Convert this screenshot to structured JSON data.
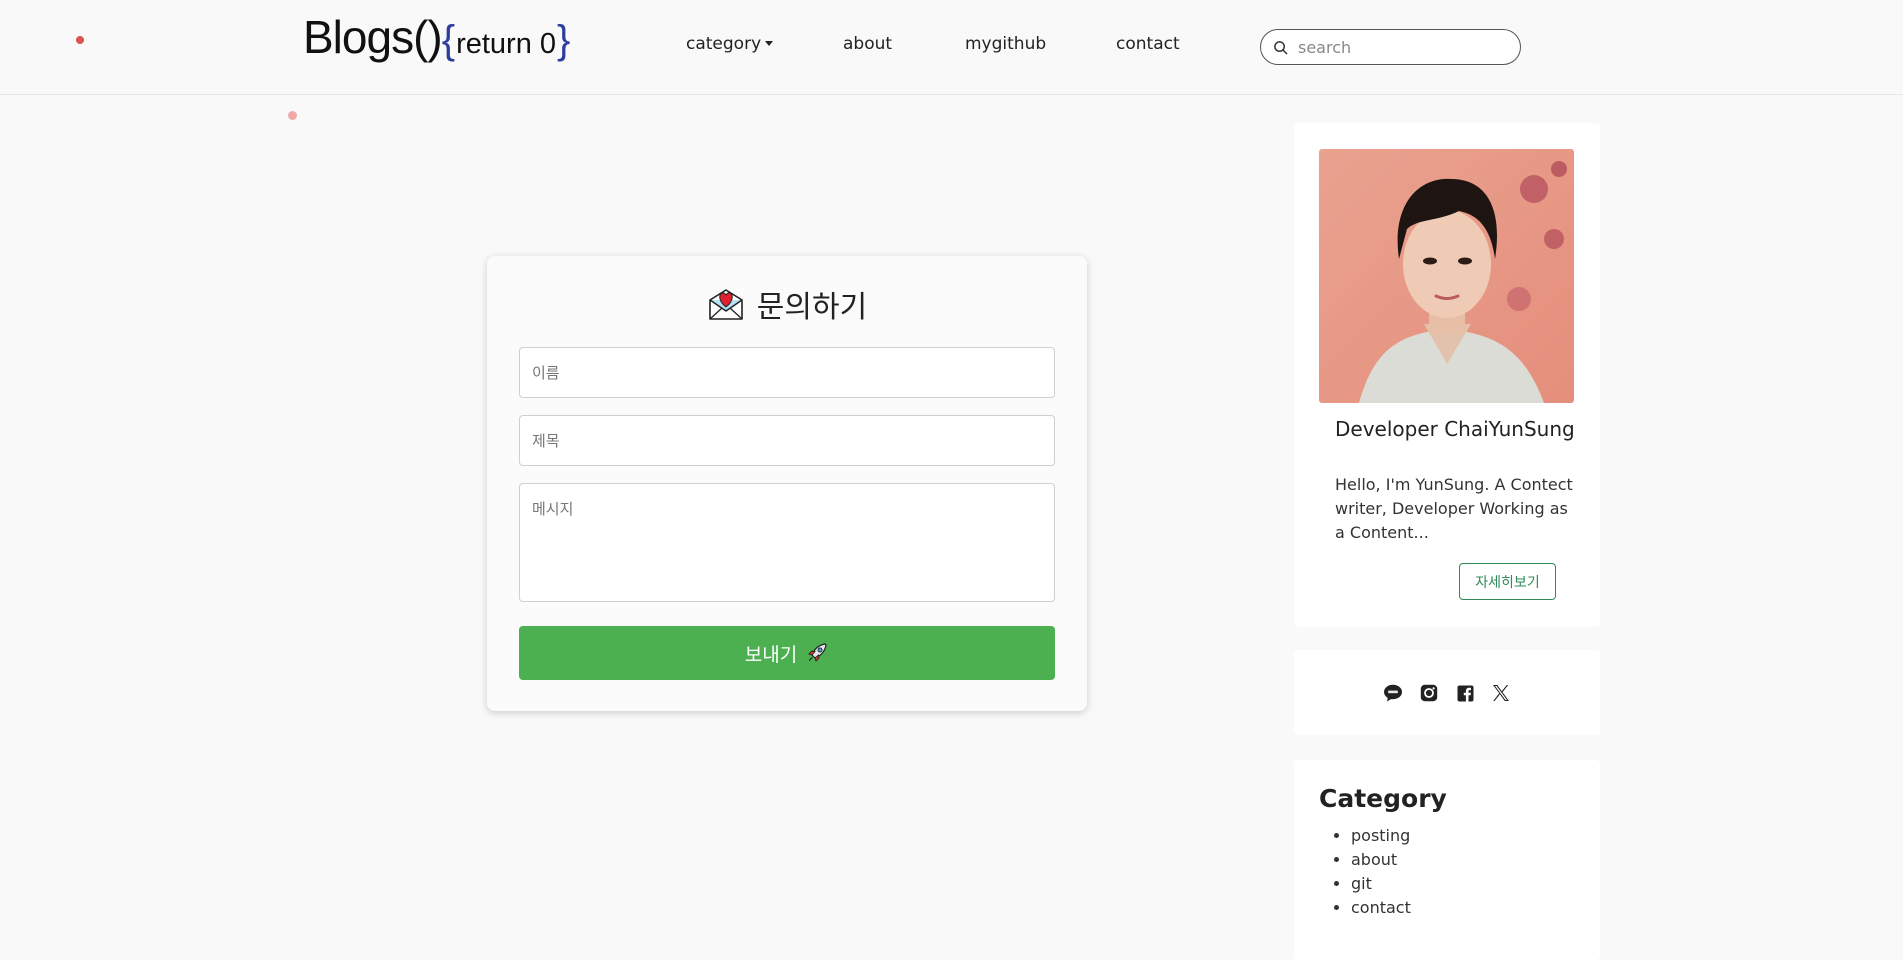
{
  "header": {
    "logo_main": "Blogs()",
    "logo_brace_open": "{",
    "logo_return": "return 0",
    "logo_brace_close": "}",
    "nav": {
      "category": "category",
      "about": "about",
      "github": "mygithub",
      "contact": "contact"
    },
    "search": {
      "placeholder": "search",
      "icon": "search-icon"
    }
  },
  "contact_form": {
    "icon": "love-letter-icon",
    "title": "문의하기",
    "name_placeholder": "이름",
    "subject_placeholder": "제목",
    "message_placeholder": "메시지",
    "send_label": "보내기",
    "send_icon": "rocket-icon",
    "button_color": "#4caf50"
  },
  "sidebar": {
    "profile": {
      "name": "Developer ChaiYunSung",
      "bio": "Hello, I'm YunSung. A Contect writer, Developer Working as a Content...",
      "more_label": "자세히보기",
      "accent_color": "#2e8b57"
    },
    "social": [
      {
        "icon": "kakaotalk-icon"
      },
      {
        "icon": "instagram-icon"
      },
      {
        "icon": "facebook-icon"
      },
      {
        "icon": "x-icon"
      }
    ],
    "category": {
      "title": "Category",
      "items": [
        "posting",
        "about",
        "git",
        "contact"
      ]
    }
  }
}
